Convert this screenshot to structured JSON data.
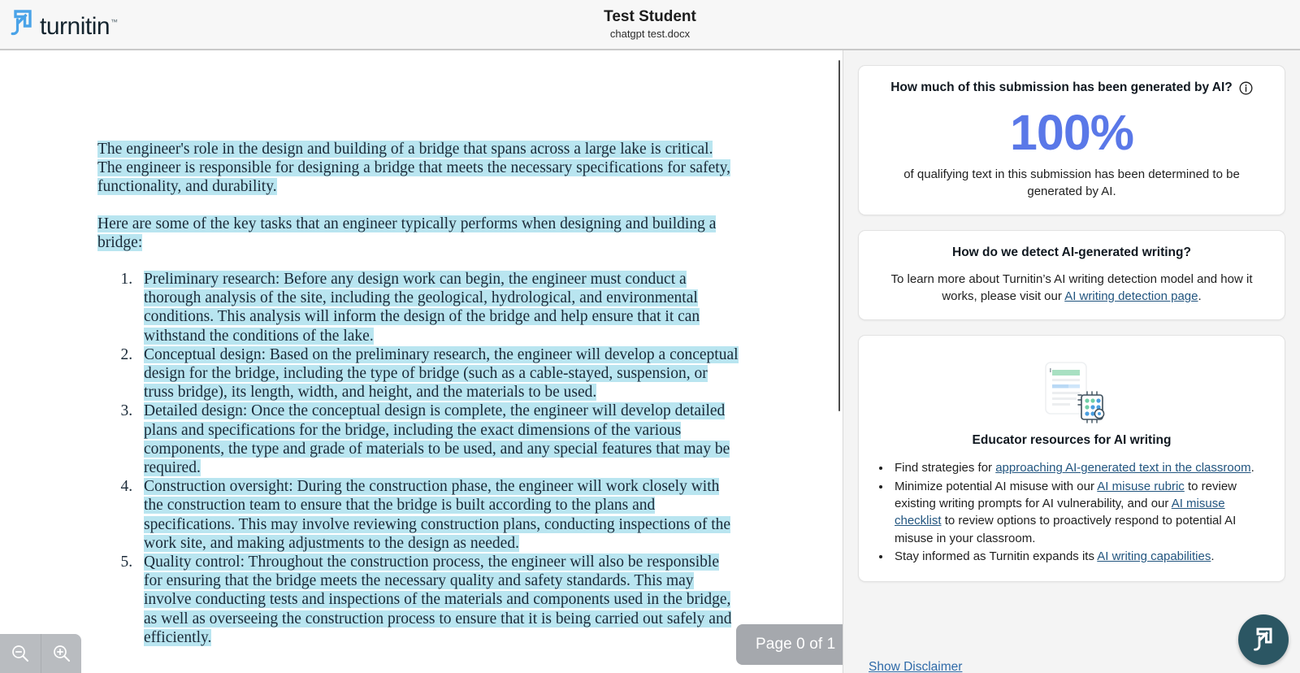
{
  "header": {
    "logo_text": "turnitin",
    "logo_tm": "™",
    "student_name": "Test Student",
    "file_name": "chatgpt test.docx"
  },
  "document": {
    "paragraphs": [
      "The engineer's role in the design and building of a bridge that spans across a large lake is critical. The engineer is responsible for designing a bridge that meets the necessary specifications for safety, functionality, and durability.",
      "Here are some of the key tasks that an engineer typically performs when designing and building a bridge:"
    ],
    "list_items": [
      "Preliminary research: Before any design work can begin, the engineer must conduct a thorough analysis of the site, including the geological, hydrological, and environmental conditions. This analysis will inform the design of the bridge and help ensure that it can withstand the conditions of the lake.",
      "Conceptual design: Based on the preliminary research, the engineer will develop a conceptual design for the bridge, including the type of bridge (such as a cable-stayed, suspension, or truss bridge), its length, width, and height, and the materials to be used.",
      "Detailed design: Once the conceptual design is complete, the engineer will develop detailed plans and specifications for the bridge, including the exact dimensions of the various components, the type and grade of materials to be used, and any special features that may be required.",
      "Construction oversight: During the construction phase, the engineer will work closely with the construction team to ensure that the bridge is built according to the plans and specifications. This may involve reviewing construction plans, conducting inspections of the work site, and making adjustments to the design as needed.",
      "Quality control: Throughout the construction process, the engineer will also be responsible for ensuring that the bridge meets the necessary quality and safety standards. This may involve conducting tests and inspections of the materials and components used in the bridge, as well as overseeing the construction process to ensure that it is being carried out safely and efficiently."
    ],
    "highlight_color": "#b9e5f0",
    "page_indicator": "Page 0 of 1",
    "zoom_out_icon": "magnifier-minus-icon",
    "zoom_in_icon": "magnifier-plus-icon"
  },
  "sidebar": {
    "score_card": {
      "question": "How much of this submission has been generated by AI?",
      "info_icon": "info-circle-icon",
      "score": "100%",
      "score_color": "#5a78e8",
      "description": "of qualifying text in this submission has been determined to be generated by AI."
    },
    "detect_card": {
      "title": "How do we detect AI-generated writing?",
      "text_before": "To learn more about Turnitin’s AI writing detection model and how it works, please visit our ",
      "link": "AI writing detection page",
      "text_after": "."
    },
    "resources_card": {
      "illustration_icon": "document-ai-chip-illustration",
      "title": "Educator resources for AI writing",
      "bullets": [
        {
          "before": "Find strategies for ",
          "link": "approaching AI-generated text in the classroom",
          "after": "."
        },
        {
          "before": "Minimize potential AI misuse with our ",
          "link": "AI misuse rubric",
          "middle": " to review existing writing prompts for AI vulnerability, and our ",
          "link2": "AI misuse checklist",
          "after": " to review options to proactively respond to potential AI misuse in your classroom."
        },
        {
          "before": "Stay informed as Turnitin expands its ",
          "link": "AI writing capabilities",
          "after": "."
        }
      ]
    },
    "disclaimer_link": "Show Disclaimer",
    "fab_icon": "turnitin-mark-icon",
    "fab_color": "#2b5663"
  }
}
